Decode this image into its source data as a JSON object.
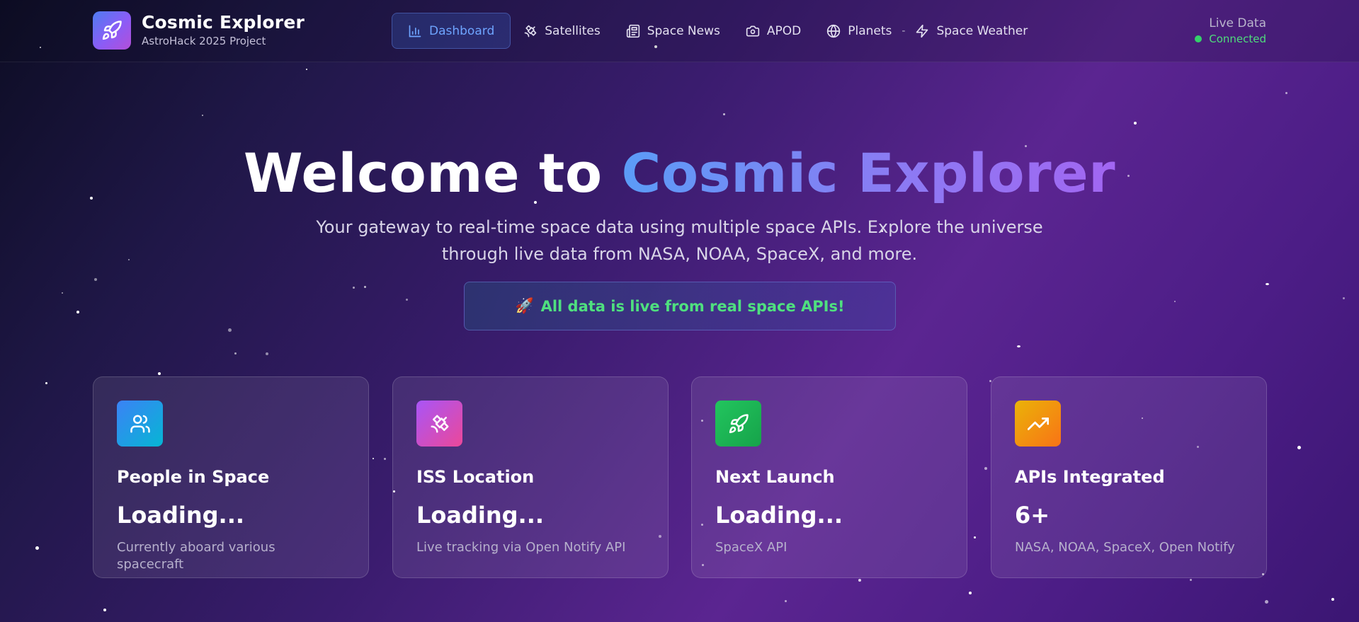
{
  "brand": {
    "title": "Cosmic Explorer",
    "subtitle": "AstroHack 2025 Project",
    "logo_icon": "rocket-icon"
  },
  "nav": {
    "items": [
      {
        "label": "Dashboard",
        "icon": "bar-chart-icon",
        "active": true
      },
      {
        "label": "Satellites",
        "icon": "satellite-icon",
        "active": false
      },
      {
        "label": "Space News",
        "icon": "newspaper-icon",
        "active": false
      },
      {
        "label": "APOD",
        "icon": "camera-icon",
        "active": false
      },
      {
        "label": "Planets",
        "icon": "globe-icon",
        "active": false
      },
      {
        "label": "Space Weather",
        "icon": "lightning-icon",
        "active": false
      }
    ],
    "separator": "-"
  },
  "status": {
    "label": "Live Data",
    "value": "Connected",
    "color": "#4fdc7c"
  },
  "hero": {
    "title_prefix": "Welcome to ",
    "title_highlight": "Cosmic Explorer",
    "subtitle": "Your gateway to real-time space data using multiple space APIs. Explore the universe through live data from NASA, NOAA, SpaceX, and more.",
    "banner_emoji": "🚀",
    "banner_text": "All data is live from real space APIs!"
  },
  "cards": [
    {
      "title": "People in Space",
      "value": "Loading...",
      "description": "Currently aboard various spacecraft",
      "icon": "users-icon",
      "colors": [
        "#3b82f6",
        "#06b6d4"
      ]
    },
    {
      "title": "ISS Location",
      "value": "Loading...",
      "description": "Live tracking via Open Notify API",
      "icon": "satellite-icon",
      "colors": [
        "#a855f7",
        "#ec4899"
      ]
    },
    {
      "title": "Next Launch",
      "value": "Loading...",
      "description": "SpaceX API",
      "icon": "rocket-icon",
      "colors": [
        "#22c55e",
        "#16a34a"
      ]
    },
    {
      "title": "APIs Integrated",
      "value": "6+",
      "description": "NASA, NOAA, SpaceX, Open Notify",
      "icon": "trending-up-icon",
      "colors": [
        "#eab308",
        "#f97316"
      ]
    }
  ],
  "colors": {
    "accent_blue": "#6ea4ff",
    "accent_green": "#4fe07f",
    "background_start": "#0d0d24",
    "background_end": "#5b2591"
  }
}
